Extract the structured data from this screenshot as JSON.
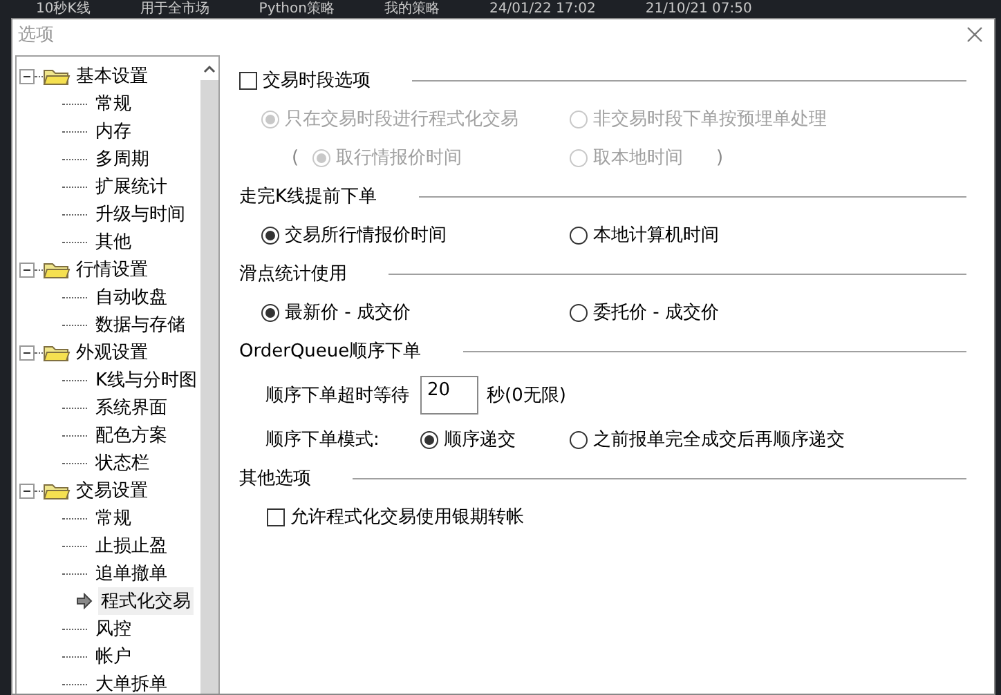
{
  "background_app": {
    "row_cells": [
      "10秒K线",
      "用于全市场",
      "Python策略",
      "我的策略",
      "24/01/22 17:02",
      "21/10/21 07:50"
    ]
  },
  "window": {
    "title": "选项"
  },
  "tree": [
    {
      "label": "基本设置",
      "expanded": true,
      "children": [
        {
          "label": "常规",
          "selected": false
        },
        {
          "label": "内存",
          "selected": false
        },
        {
          "label": "多周期",
          "selected": false
        },
        {
          "label": "扩展统计",
          "selected": false
        },
        {
          "label": "升级与时间",
          "selected": false
        },
        {
          "label": "其他",
          "selected": false
        }
      ]
    },
    {
      "label": "行情设置",
      "expanded": true,
      "children": [
        {
          "label": "自动收盘",
          "selected": false
        },
        {
          "label": "数据与存储",
          "selected": false
        }
      ]
    },
    {
      "label": "外观设置",
      "expanded": true,
      "children": [
        {
          "label": "K线与分时图",
          "selected": false
        },
        {
          "label": "系统界面",
          "selected": false
        },
        {
          "label": "配色方案",
          "selected": false
        },
        {
          "label": "状态栏",
          "selected": false
        }
      ]
    },
    {
      "label": "交易设置",
      "expanded": true,
      "children": [
        {
          "label": "常规",
          "selected": false
        },
        {
          "label": "止损止盈",
          "selected": false
        },
        {
          "label": "追单撤单",
          "selected": false
        },
        {
          "label": "程式化交易",
          "selected": true
        },
        {
          "label": "风控",
          "selected": false
        },
        {
          "label": "帐户",
          "selected": false
        },
        {
          "label": "大单拆单",
          "selected": false
        }
      ]
    }
  ],
  "sections": [
    {
      "kind": "checkbox",
      "title": "交易时段选项",
      "checked": false,
      "rows": [
        {
          "kind": "radios",
          "disabled": true,
          "options": [
            {
              "label": "只在交易时段进行程式化交易",
              "selected": true
            },
            {
              "label": "非交易时段下单按预埋单处理",
              "selected": false
            }
          ]
        },
        {
          "kind": "paren",
          "disabled": true,
          "open": "(",
          "close": ")",
          "options": [
            {
              "label": "取行情报价时间",
              "selected": true
            },
            {
              "label": "取本地时间",
              "selected": false
            }
          ]
        }
      ]
    },
    {
      "kind": "plain",
      "title": "走完K线提前下单",
      "rows": [
        {
          "kind": "radios",
          "disabled": false,
          "options": [
            {
              "label": "交易所行情报价时间",
              "selected": true
            },
            {
              "label": "本地计算机时间",
              "selected": false
            }
          ]
        }
      ]
    },
    {
      "kind": "plain",
      "title": "滑点统计使用",
      "rows": [
        {
          "kind": "radios",
          "disabled": false,
          "options": [
            {
              "label": "最新价 - 成交价",
              "selected": true
            },
            {
              "label": "委托价 - 成交价",
              "selected": false
            }
          ]
        }
      ]
    },
    {
      "kind": "plain",
      "title": "OrderQueue顺序下单",
      "rows": [
        {
          "kind": "field",
          "label": "顺序下单超时等待",
          "value": "20",
          "unit": "秒(0无限)"
        },
        {
          "kind": "labeled-radios",
          "label": "顺序下单模式:",
          "options": [
            {
              "label": "顺序递交",
              "selected": true
            },
            {
              "label": "之前报单完全成交后再顺序递交",
              "selected": false
            }
          ]
        }
      ]
    },
    {
      "kind": "plain",
      "title": "其他选项",
      "rows": [
        {
          "kind": "check",
          "label": "允许程式化交易使用银期转帐",
          "checked": false
        }
      ]
    }
  ]
}
